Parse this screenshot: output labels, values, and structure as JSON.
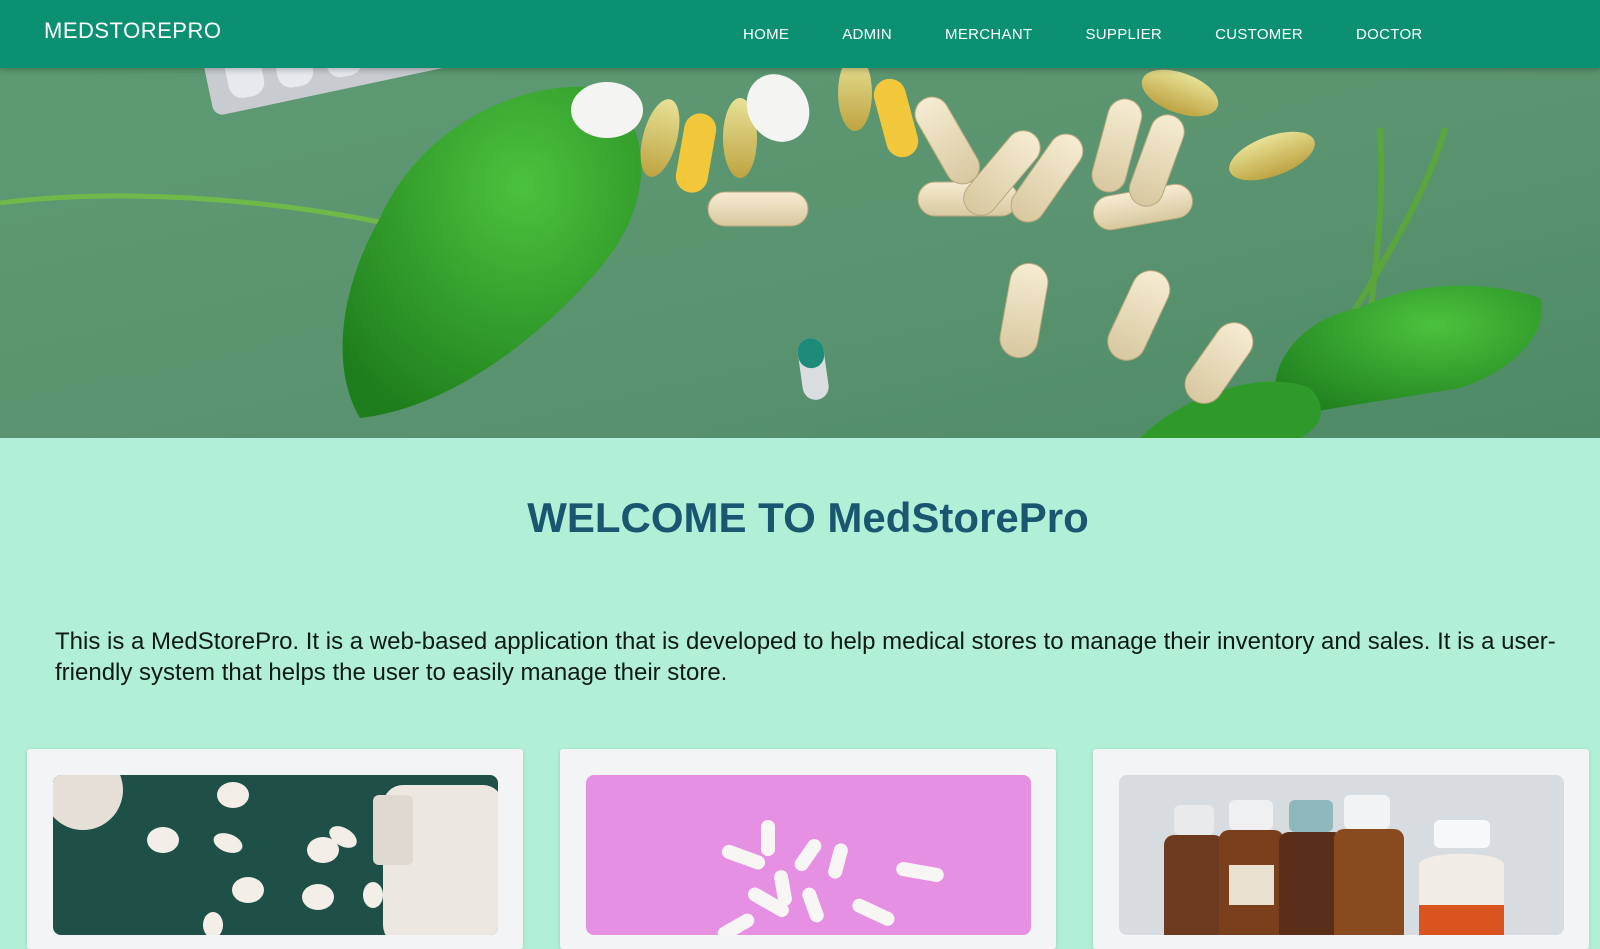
{
  "navbar": {
    "brand": "MEDSTOREPRO",
    "links": [
      {
        "label": "HOME"
      },
      {
        "label": "ADMIN"
      },
      {
        "label": "MERCHANT"
      },
      {
        "label": "SUPPLIER"
      },
      {
        "label": "CUSTOMER"
      },
      {
        "label": "DOCTOR"
      }
    ],
    "background": "#0b9072"
  },
  "main": {
    "welcome_heading": "WELCOME TO MedStorePro",
    "intro_text": "This is a MedStorePro. It is a web-based application that is developed to help medical stores to manage their inventory and sales. It is a user-friendly system that helps the user to easily manage their store.",
    "background": "#b1efd7",
    "heading_color": "#1a5670"
  },
  "cards": [
    {
      "image": "pills-spilled-from-bottle-on-green-cloth"
    },
    {
      "image": "white-capsules-on-pink-background"
    },
    {
      "image": "medicine-bottles-syrup"
    }
  ]
}
